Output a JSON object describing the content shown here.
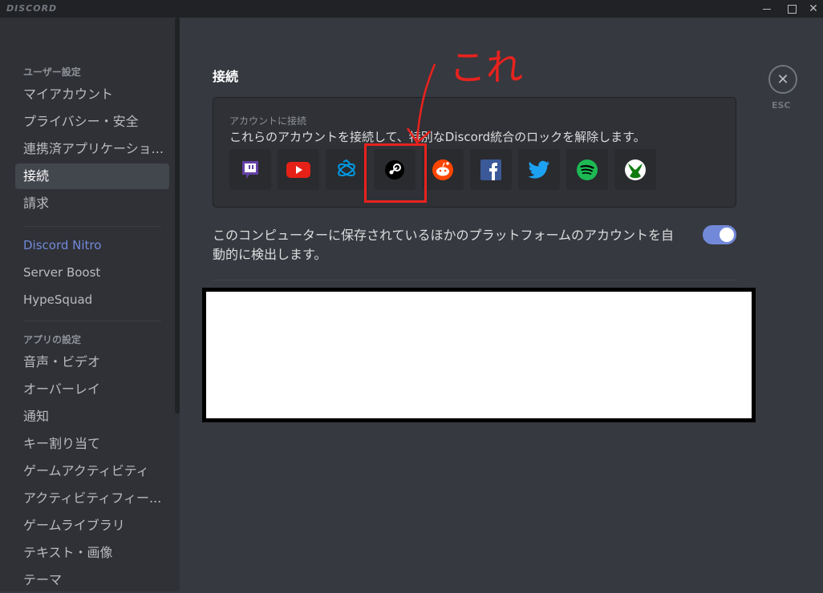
{
  "window": {
    "app_name": "DISCORD",
    "minimize_glyph": "",
    "maximize_glyph": "",
    "close_glyph": "✕"
  },
  "sidebar": {
    "user_settings_header": "ユーザー設定",
    "user_items": [
      {
        "label": "マイアカウント"
      },
      {
        "label": "プライバシー・安全"
      },
      {
        "label": "連携済アプリケーショ..."
      },
      {
        "label": "接続",
        "selected": true
      },
      {
        "label": "請求"
      }
    ],
    "nitro_items": [
      {
        "label": "Discord Nitro"
      },
      {
        "label": "Server Boost"
      },
      {
        "label": "HypeSquad"
      }
    ],
    "app_settings_header": "アプリの設定",
    "app_items": [
      {
        "label": "音声・ビデオ"
      },
      {
        "label": "オーバーレイ"
      },
      {
        "label": "通知"
      },
      {
        "label": "キー割り当て"
      },
      {
        "label": "ゲームアクティビティ"
      },
      {
        "label": "アクティビティフィー..."
      },
      {
        "label": "ゲームライブラリ"
      },
      {
        "label": "テキスト・画像"
      },
      {
        "label": "テーマ"
      }
    ]
  },
  "main": {
    "title": "接続",
    "connect": {
      "label": "アカウントに接続",
      "description": "これらのアカウントを接続して、特別なDiscord統合のロックを解除します。",
      "services": [
        {
          "name": "twitch",
          "icon": "twitch-icon",
          "color": "#6441a5"
        },
        {
          "name": "youtube",
          "icon": "youtube-icon",
          "color": "#e62117"
        },
        {
          "name": "battlenet",
          "icon": "battlenet-icon",
          "color": "#009ae4"
        },
        {
          "name": "steam",
          "icon": "steam-icon",
          "color": "#000000"
        },
        {
          "name": "reddit",
          "icon": "reddit-icon",
          "color": "#ff4500"
        },
        {
          "name": "facebook",
          "icon": "facebook-icon",
          "color": "#3b5998"
        },
        {
          "name": "twitter",
          "icon": "twitter-icon",
          "color": "#1da1f2"
        },
        {
          "name": "spotify",
          "icon": "spotify-icon",
          "color": "#1db954"
        },
        {
          "name": "xbox",
          "icon": "xbox-icon",
          "color": "#107c10"
        }
      ]
    },
    "autodetect": {
      "text": "このコンピューターに保存されているほかのプラットフォームのアカウントを自動的に検出します。",
      "enabled": true
    },
    "close": {
      "glyph": "✕",
      "label": "ESC"
    }
  },
  "annotation": {
    "text": "これ",
    "color": "#e8221e"
  },
  "colors": {
    "accent": "#7289da",
    "background": "#36393f",
    "sidebar": "#2f3136"
  }
}
